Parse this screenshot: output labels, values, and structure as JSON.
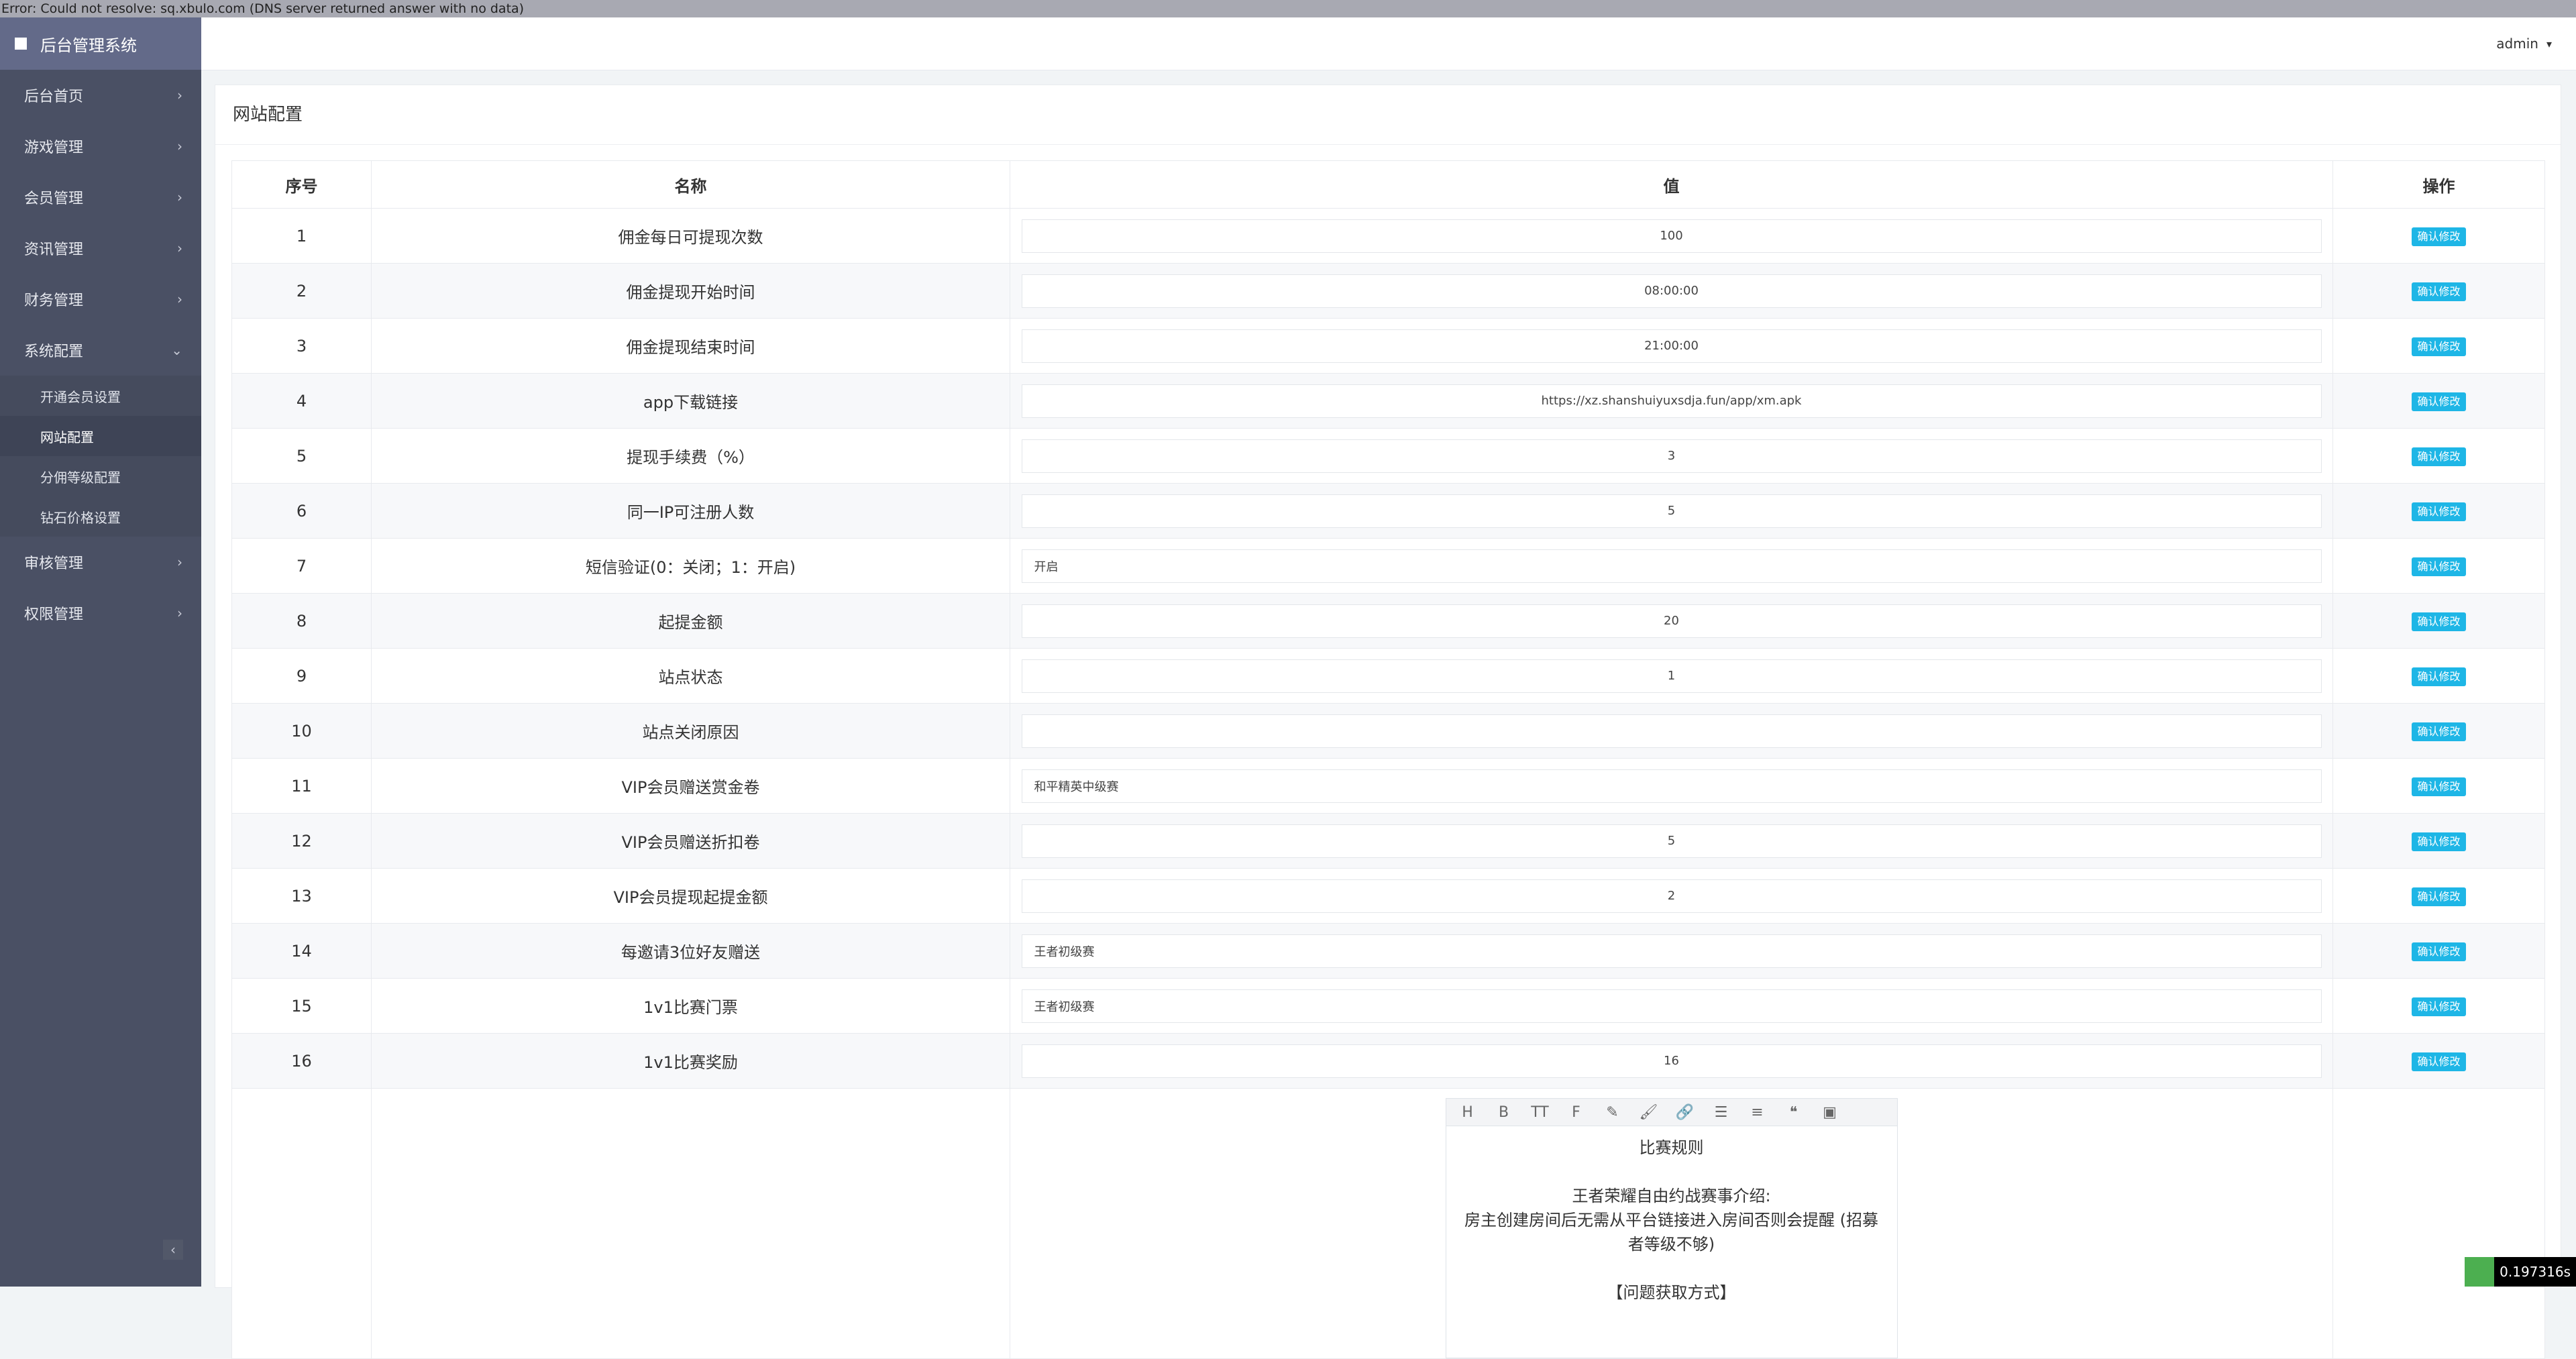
{
  "error_bar": "Error: Could not resolve: sq.xbulo.com (DNS server returned answer with no data)",
  "sidebar": {
    "brand": "后台管理系统",
    "items": [
      {
        "label": "后台首页"
      },
      {
        "label": "游戏管理"
      },
      {
        "label": "会员管理"
      },
      {
        "label": "资讯管理"
      },
      {
        "label": "财务管理"
      },
      {
        "label": "系统配置",
        "expanded": true,
        "children": [
          {
            "label": "开通会员设置"
          },
          {
            "label": "网站配置",
            "active": true
          },
          {
            "label": "分佣等级配置"
          },
          {
            "label": "钻石价格设置"
          }
        ]
      },
      {
        "label": "审核管理"
      },
      {
        "label": "权限管理"
      }
    ],
    "collapse_glyph": "‹"
  },
  "header": {
    "user": "admin"
  },
  "panel": {
    "title": "网站配置"
  },
  "table": {
    "headers": [
      "序号",
      "名称",
      "值",
      "操作"
    ],
    "action_label": "确认修改",
    "rows": [
      {
        "id": "1",
        "name": "佣金每日可提现次数",
        "value": "100"
      },
      {
        "id": "2",
        "name": "佣金提现开始时间",
        "value": "08:00:00"
      },
      {
        "id": "3",
        "name": "佣金提现结束时间",
        "value": "21:00:00"
      },
      {
        "id": "4",
        "name": "app下载链接",
        "value": "https://xz.shanshuiyuxsdja.fun/app/xm.apk"
      },
      {
        "id": "5",
        "name": "提现手续费（%）",
        "value": "3"
      },
      {
        "id": "6",
        "name": "同一IP可注册人数",
        "value": "5"
      },
      {
        "id": "7",
        "name": "短信验证(0：关闭；1：开启)",
        "value": "开启",
        "align": "left"
      },
      {
        "id": "8",
        "name": "起提金额",
        "value": "20"
      },
      {
        "id": "9",
        "name": "站点状态",
        "value": "1"
      },
      {
        "id": "10",
        "name": "站点关闭原因",
        "value": ""
      },
      {
        "id": "11",
        "name": "VIP会员赠送赏金卷",
        "value": "和平精英中级赛",
        "align": "left"
      },
      {
        "id": "12",
        "name": "VIP会员赠送折扣卷",
        "value": "5"
      },
      {
        "id": "13",
        "name": "VIP会员提现起提金额",
        "value": "2"
      },
      {
        "id": "14",
        "name": "每邀请3位好友赠送",
        "value": "王者初级赛",
        "align": "left"
      },
      {
        "id": "15",
        "name": "1v1比赛门票",
        "value": "王者初级赛",
        "align": "left"
      },
      {
        "id": "16",
        "name": "1v1比赛奖励",
        "value": "16"
      }
    ],
    "editor": {
      "toolbar_icons": [
        "heading-icon",
        "bold-icon",
        "text-size-icon",
        "font-icon",
        "highlighter-icon",
        "brush-icon",
        "link-icon",
        "list-icon",
        "align-icon",
        "quote-icon",
        "image-icon"
      ],
      "toolbar_glyphs": [
        "H",
        "B",
        "TT",
        "F",
        "✎",
        "🖌",
        "🔗",
        "☰",
        "≡",
        "❝",
        "▣"
      ],
      "lines": [
        "比赛规则",
        "",
        "王者荣耀自由约战赛事介绍:",
        "房主创建房间后无需从平台链接进入房间否则会提醒 (招募者等级不够)",
        "",
        "【问题获取方式】"
      ]
    }
  },
  "timer": "0.197316s"
}
